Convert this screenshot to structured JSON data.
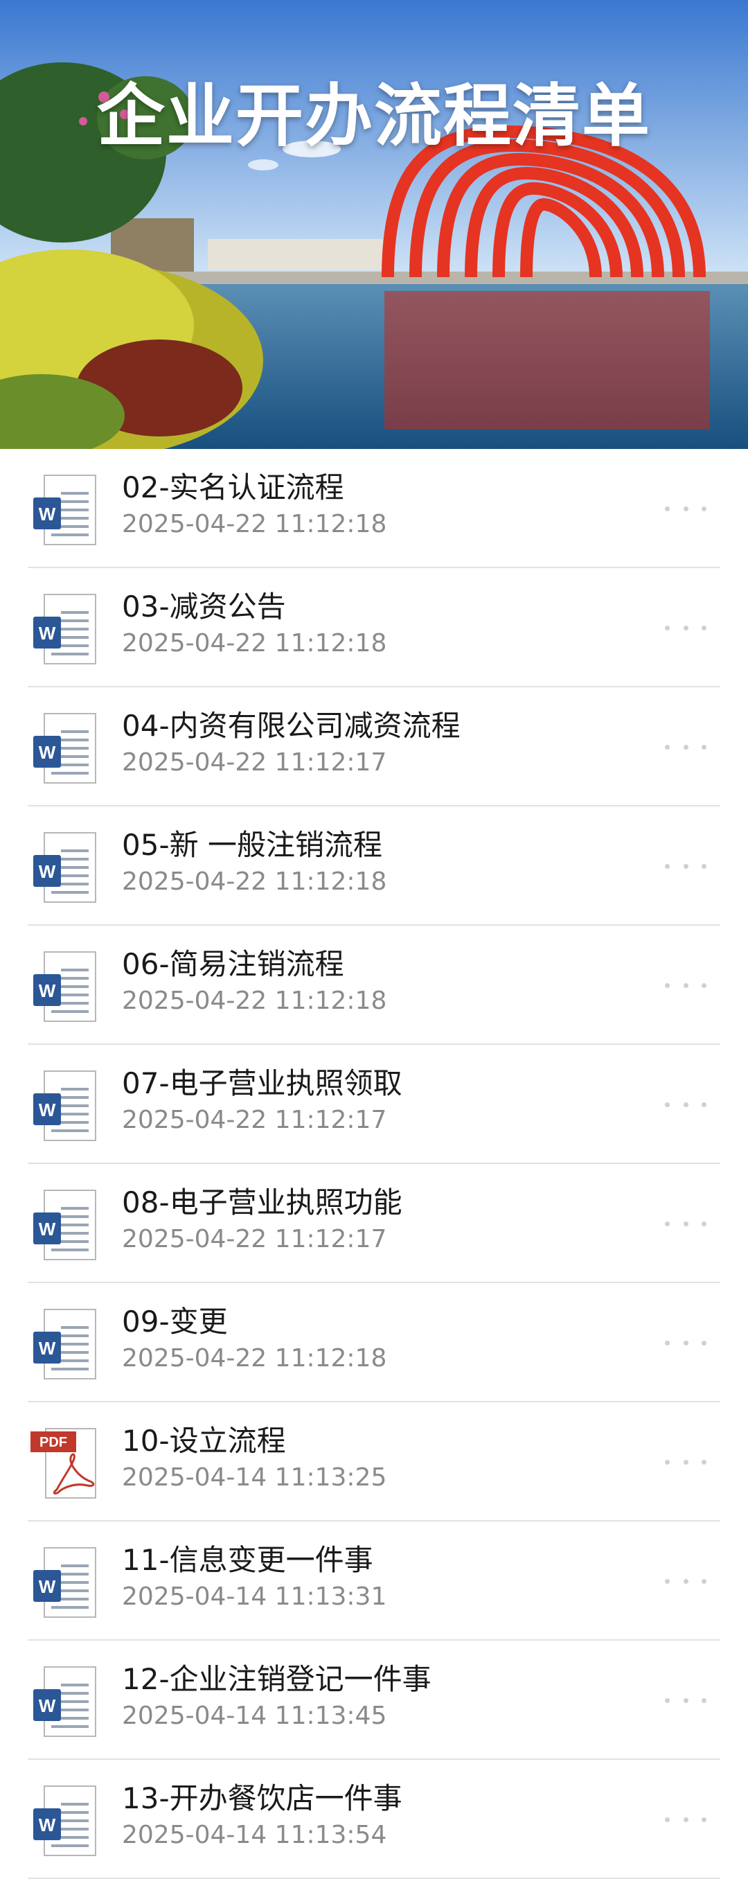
{
  "banner": {
    "title": "企业开办流程清单"
  },
  "files": [
    {
      "type": "word",
      "title": "02-实名认证流程",
      "time": "2025-04-22 11:12:18"
    },
    {
      "type": "word",
      "title": "03-减资公告",
      "time": "2025-04-22 11:12:18"
    },
    {
      "type": "word",
      "title": "04-内资有限公司减资流程",
      "time": "2025-04-22 11:12:17"
    },
    {
      "type": "word",
      "title": "05-新 一般注销流程",
      "time": "2025-04-22 11:12:18"
    },
    {
      "type": "word",
      "title": "06-简易注销流程",
      "time": "2025-04-22 11:12:18"
    },
    {
      "type": "word",
      "title": "07-电子营业执照领取",
      "time": "2025-04-22 11:12:17"
    },
    {
      "type": "word",
      "title": "08-电子营业执照功能",
      "time": "2025-04-22 11:12:17"
    },
    {
      "type": "word",
      "title": "09-变更",
      "time": "2025-04-22 11:12:18"
    },
    {
      "type": "pdf",
      "title": "10-设立流程",
      "time": "2025-04-14 11:13:25"
    },
    {
      "type": "word",
      "title": "11-信息变更一件事",
      "time": "2025-04-14 11:13:31"
    },
    {
      "type": "word",
      "title": "12-企业注销登记一件事",
      "time": "2025-04-14 11:13:45"
    },
    {
      "type": "word",
      "title": "13-开办餐饮店一件事",
      "time": "2025-04-14 11:13:54"
    }
  ],
  "icons": {
    "word": "word-document-icon",
    "pdf": "pdf-document-icon",
    "more": "more-dots-icon"
  },
  "colors": {
    "word_blue": "#2b5797",
    "pdf_red": "#c0392b",
    "sculpture_red": "#e0301e"
  }
}
